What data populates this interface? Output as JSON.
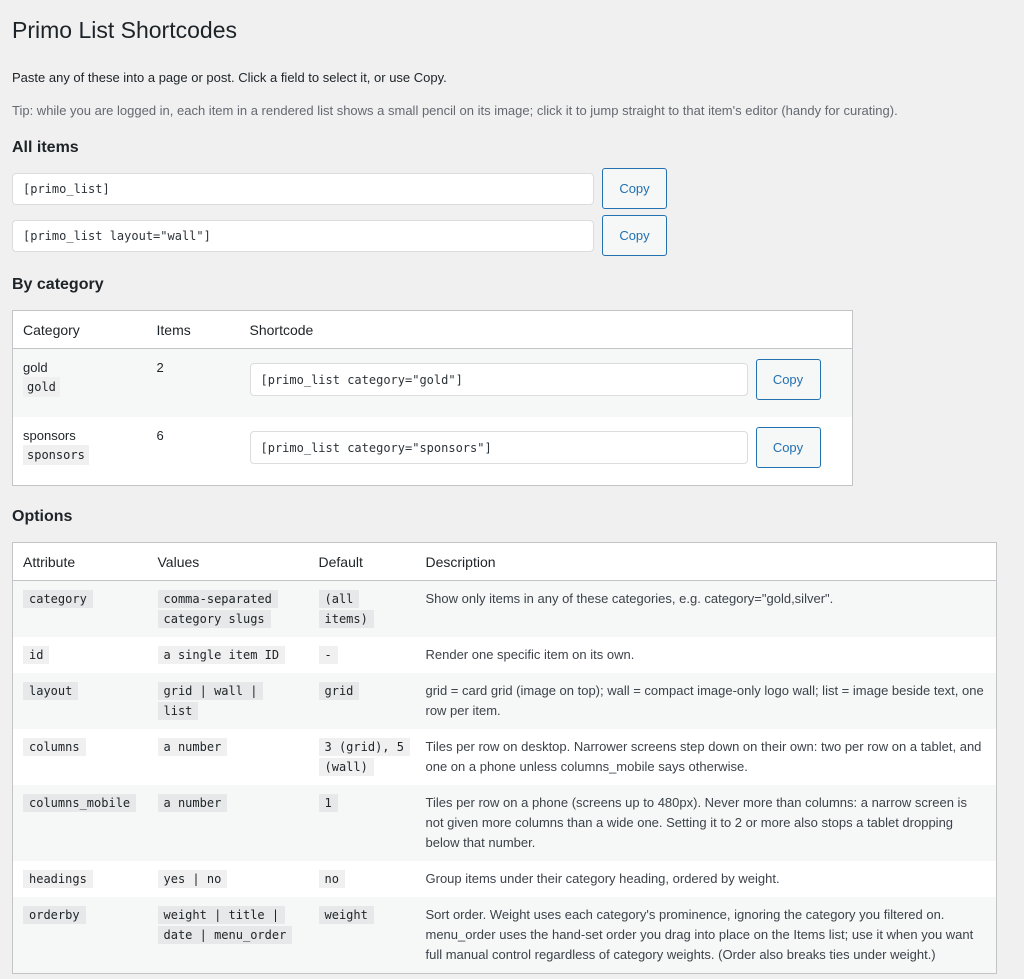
{
  "page": {
    "title": "Primo List Shortcodes",
    "intro": "Paste any of these into a page or post. Click a field to select it, or use Copy.",
    "tip": "Tip: while you are logged in, each item in a rendered list shows a small pencil on its image; click it to jump straight to that item's editor (handy for curating)."
  },
  "all_items": {
    "heading": "All items",
    "shortcodes": [
      {
        "value": "[primo_list]",
        "copy_label": "Copy"
      },
      {
        "value": "[primo_list layout=\"wall\"]",
        "copy_label": "Copy"
      }
    ]
  },
  "by_category": {
    "heading": "By category",
    "columns": [
      "Category",
      "Items",
      "Shortcode"
    ],
    "rows": [
      {
        "name": "gold",
        "slug": "gold",
        "count": "2",
        "shortcode": "[primo_list category=\"gold\"]",
        "copy_label": "Copy"
      },
      {
        "name": "sponsors",
        "slug": "sponsors",
        "count": "6",
        "shortcode": "[primo_list category=\"sponsors\"]",
        "copy_label": "Copy"
      }
    ]
  },
  "options": {
    "heading": "Options",
    "columns": [
      "Attribute",
      "Values",
      "Default",
      "Description"
    ],
    "rows": [
      {
        "attr": "category",
        "values": "comma-separated category slugs",
        "default": "(all items)",
        "desc": "Show only items in any of these categories, e.g. category=\"gold,silver\"."
      },
      {
        "attr": "id",
        "values": "a single item ID",
        "default": "-",
        "desc": "Render one specific item on its own."
      },
      {
        "attr": "layout",
        "values": "grid | wall | list",
        "default": "grid",
        "desc": "grid = card grid (image on top); wall = compact image-only logo wall; list = image beside text, one row per item."
      },
      {
        "attr": "columns",
        "values": "a number",
        "default": "3 (grid), 5 (wall)",
        "desc": "Tiles per row on desktop. Narrower screens step down on their own: two per row on a tablet, and one on a phone unless columns_mobile says otherwise."
      },
      {
        "attr": "columns_mobile",
        "values": "a number",
        "default": "1",
        "desc": "Tiles per row on a phone (screens up to 480px). Never more than columns: a narrow screen is not given more columns than a wide one. Setting it to 2 or more also stops a tablet dropping below that number."
      },
      {
        "attr": "headings",
        "values": "yes | no",
        "default": "no",
        "desc": "Group items under their category heading, ordered by weight."
      },
      {
        "attr": "orderby",
        "values": "weight | title | date | menu_order",
        "default": "weight",
        "desc": "Sort order. Weight uses each category's prominence, ignoring the category you filtered on. menu_order uses the hand-set order you drag into place on the Items list; use it when you want full manual control regardless of category weights. (Order also breaks ties under weight.)"
      }
    ]
  }
}
